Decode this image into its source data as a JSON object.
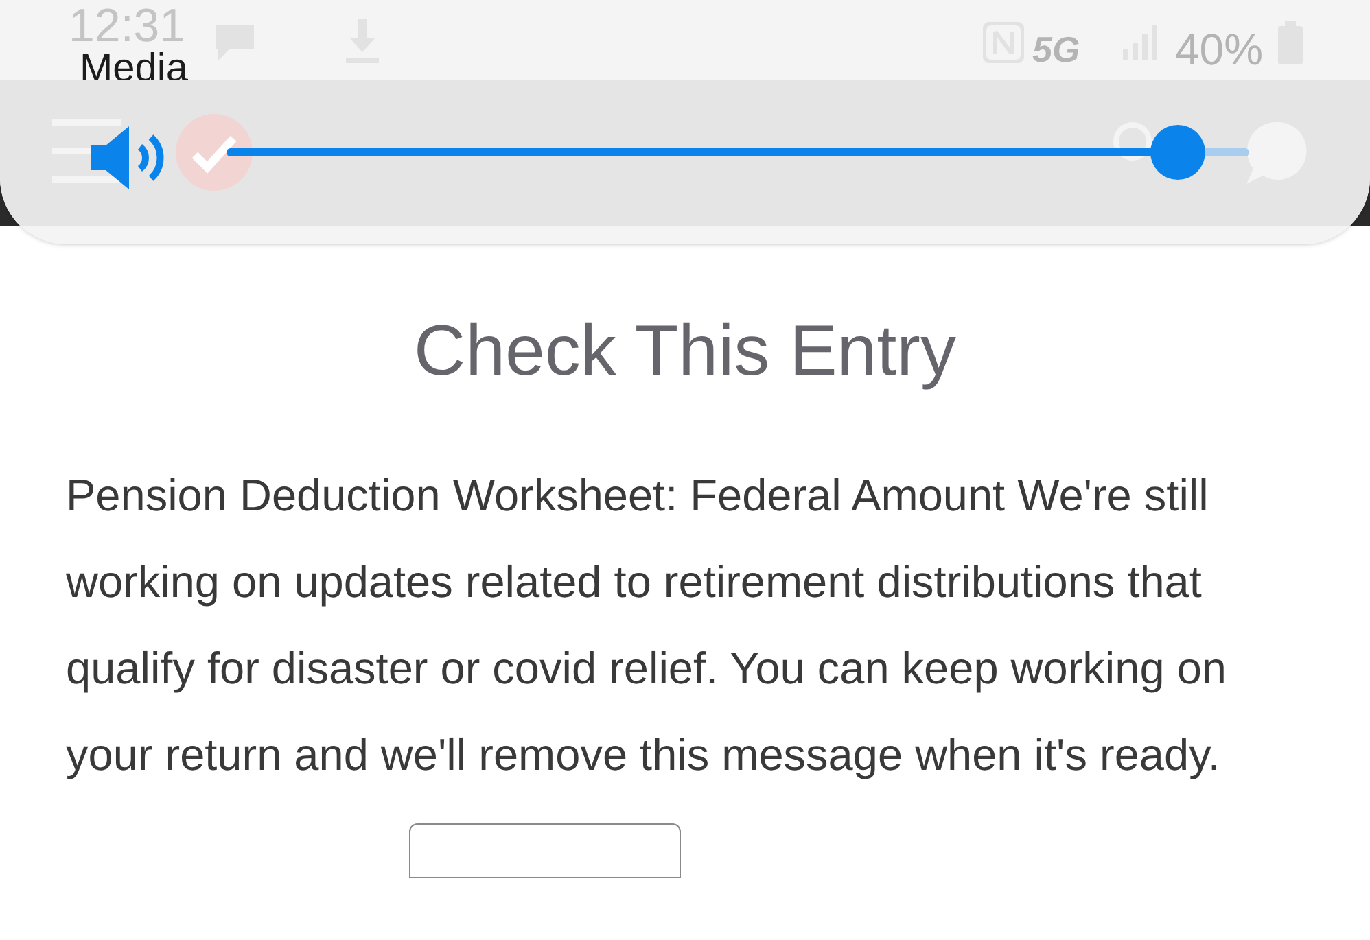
{
  "status_bar": {
    "time": "12:31",
    "network": "5G",
    "battery": "40%"
  },
  "volume_panel": {
    "label": "Media",
    "level": 0.93
  },
  "page": {
    "title": "Check This Entry",
    "message": "Pension Deduction Worksheet: Federal Amount We're still working on updates related to retirement distributions that qualify for disaster or covid relief. You can keep working on your return and we'll remove this message when it's ready."
  }
}
